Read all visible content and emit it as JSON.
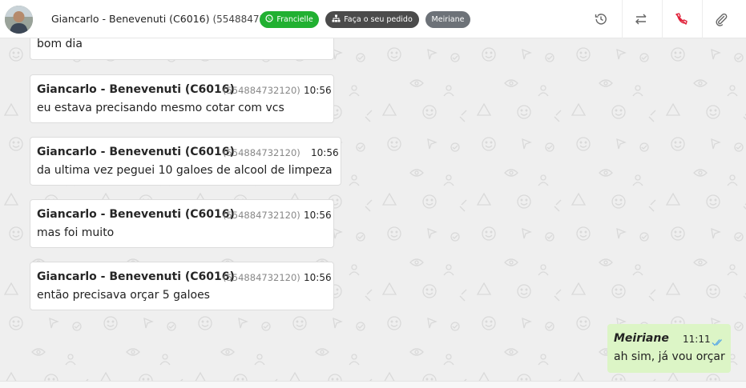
{
  "header": {
    "contact_name": "Giancarlo - Benevenuti (C6016)",
    "contact_number": "(554884732120)",
    "tags": {
      "whatsapp_agent": "Francielle",
      "order_button": "Faça o seu pedido",
      "assignee": "Meiriane"
    },
    "actions": [
      "history-icon",
      "transfer-icon",
      "end-call-icon",
      "attach-icon"
    ],
    "colors": {
      "green": "#21b031",
      "dark": "#4b4b4b",
      "gray": "#6d7278",
      "red": "#e0243c"
    }
  },
  "messages": [
    {
      "text": "bom dia"
    },
    {
      "sender": "Giancarlo - Benevenuti (C6016)",
      "number": "(554884732120)",
      "time": "10:56",
      "text": "eu estava precisando mesmo cotar com vcs"
    },
    {
      "sender": "Giancarlo - Benevenuti (C6016)",
      "number": "(554884732120)",
      "time": "10:56",
      "text": "da ultima vez peguei 10 galoes de alcool de limpeza"
    },
    {
      "sender": "Giancarlo - Benevenuti (C6016)",
      "number": "(554884732120)",
      "time": "10:56",
      "text": "mas foi muito"
    },
    {
      "sender": "Giancarlo - Benevenuti (C6016)",
      "number": "(554884732120)",
      "time": "10:56",
      "text": "então precisava orçar 5 galoes"
    }
  ],
  "reply": {
    "sender": "Meiriane",
    "time": "11:11",
    "text": "ah sim, já vou orçar",
    "status_icon": "double-check-icon"
  }
}
